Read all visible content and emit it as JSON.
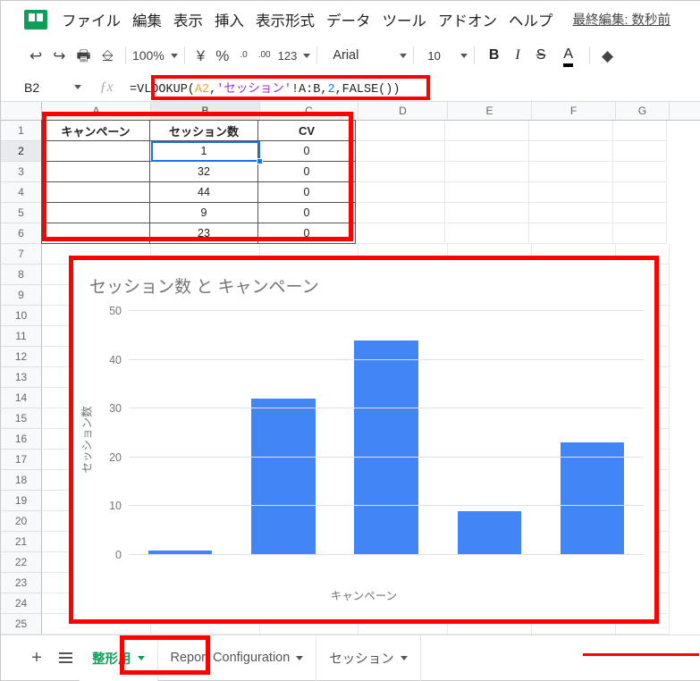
{
  "app": {
    "logo_icon": "sheets-logo-icon",
    "menu": [
      "ファイル",
      "編集",
      "表示",
      "挿入",
      "表示形式",
      "データ",
      "ツール",
      "アドオン",
      "ヘルプ"
    ],
    "last_edit": "最終編集: 数秒前"
  },
  "toolbar": {
    "undo_icon": "undo-icon",
    "redo_icon": "redo-icon",
    "print_icon": "print-icon",
    "paint_format_icon": "paint-format-icon",
    "zoom_value": "100%",
    "currency_label": "¥",
    "percent_label": "%",
    "decrease_decimal_label": ".0",
    "increase_decimal_label": ".00",
    "number_format_label": "123",
    "font_family_value": "Arial",
    "font_size_value": "10",
    "bold_label": "B",
    "italic_label": "I",
    "strikethrough_label": "S",
    "text_color_label": "A"
  },
  "formula_bar": {
    "name_box_value": "B2",
    "fx_label": "fx",
    "formula_parts": [
      {
        "text": "=VLOOKUP(",
        "kind": "plain"
      },
      {
        "text": "A2",
        "kind": "ref"
      },
      {
        "text": ",",
        "kind": "plain"
      },
      {
        "text": "'セッション'",
        "kind": "str"
      },
      {
        "text": "!A:B,",
        "kind": "plain"
      },
      {
        "text": "2",
        "kind": "num"
      },
      {
        "text": ",FALSE())",
        "kind": "plain"
      }
    ],
    "formula_text": "=VLOOKUP(A2,'セッション'!A:B,2,FALSE())"
  },
  "grid": {
    "columns": [
      "A",
      "B",
      "C",
      "D",
      "E",
      "F",
      "G"
    ],
    "selected_column": "B",
    "selected_row": "2",
    "selected_cell": "B2",
    "rows": [
      "1",
      "2",
      "3",
      "4",
      "5",
      "6",
      "7",
      "8",
      "9",
      "10",
      "11",
      "12",
      "13",
      "14",
      "15",
      "16",
      "17",
      "18",
      "19",
      "20",
      "21",
      "22",
      "23",
      "24",
      "25"
    ],
    "data_rows": [
      {
        "row": "1",
        "A": "キャンペーン",
        "B": "セッション数",
        "C": "CV"
      },
      {
        "row": "2",
        "A": "",
        "B": "1",
        "C": "0"
      },
      {
        "row": "3",
        "A": "",
        "B": "32",
        "C": "0"
      },
      {
        "row": "4",
        "A": "",
        "B": "44",
        "C": "0"
      },
      {
        "row": "5",
        "A": "",
        "B": "9",
        "C": "0"
      },
      {
        "row": "6",
        "A": "",
        "B": "23",
        "C": "0"
      }
    ]
  },
  "chart_data": {
    "type": "bar",
    "title": "セッション数 と キャンペーン",
    "xlabel": "キャンペーン",
    "ylabel": "セッション数",
    "categories": [
      "",
      "",
      "",
      "",
      ""
    ],
    "values": [
      1,
      32,
      44,
      9,
      23
    ],
    "ylim": [
      0,
      50
    ],
    "yticks": [
      0,
      10,
      20,
      30,
      40,
      50
    ],
    "grid": true,
    "legend": "none",
    "bar_color": "#4285f4",
    "title_color": "#757575",
    "axis_text_color": "#757575"
  },
  "sheet_tabs": {
    "add_sheet_label": "+",
    "all_sheets_icon": "hamburger-icon",
    "tabs": [
      {
        "label": "整形用",
        "active": true
      },
      {
        "label": "Report Configuration",
        "active": false
      },
      {
        "label": "セッション",
        "active": false
      }
    ]
  },
  "highlight_color": "#ff0000"
}
